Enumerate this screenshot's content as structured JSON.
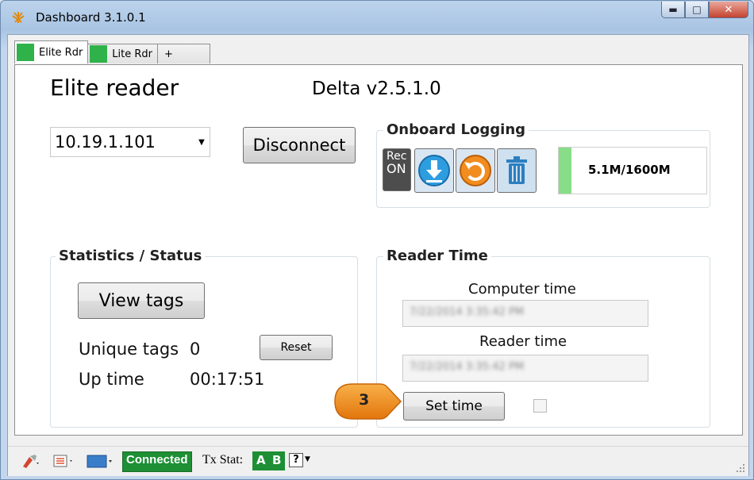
{
  "window": {
    "title": "Dashboard 3.1.0.1"
  },
  "tabs": [
    {
      "label": "Elite Rdr"
    },
    {
      "label": "Lite Rdr"
    },
    {
      "label": "+"
    }
  ],
  "reader": {
    "name": "Elite reader",
    "version": "Delta v2.5.1.0",
    "ip_selected": "10.19.1.101",
    "disconnect_label": "Disconnect"
  },
  "onboard_logging": {
    "title": "Onboard Logging",
    "rec_line1": "Rec",
    "rec_line2": "ON",
    "icons": [
      "rec-on-icon",
      "download-icon",
      "undo-icon",
      "trash-icon"
    ],
    "storage_text": "5.1M/1600M",
    "storage_fraction": 0.0032
  },
  "stats": {
    "title": "Statistics / Status",
    "view_tags_label": "View tags",
    "unique_tags_label": "Unique tags",
    "unique_tags_value": "0",
    "reset_label": "Reset",
    "uptime_label": "Up time",
    "uptime_value": "00:17:51"
  },
  "reader_time": {
    "title": "Reader Time",
    "computer_time_label": "Computer time",
    "computer_time_value": "7/22/2014 3:35:42 PM",
    "reader_time_label": "Reader time",
    "reader_time_value": "7/22/2014 3:35:42 PM",
    "set_time_label": "Set time"
  },
  "callout": {
    "number": "3",
    "color": "#f08a1c"
  },
  "statusbar": {
    "connected": "Connected",
    "tx_stat_label": "Tx Stat:",
    "a": "A",
    "b": "B",
    "help": "?"
  },
  "colors": {
    "connected_green": "#1e8f34",
    "tab_green": "#2fb24a"
  }
}
